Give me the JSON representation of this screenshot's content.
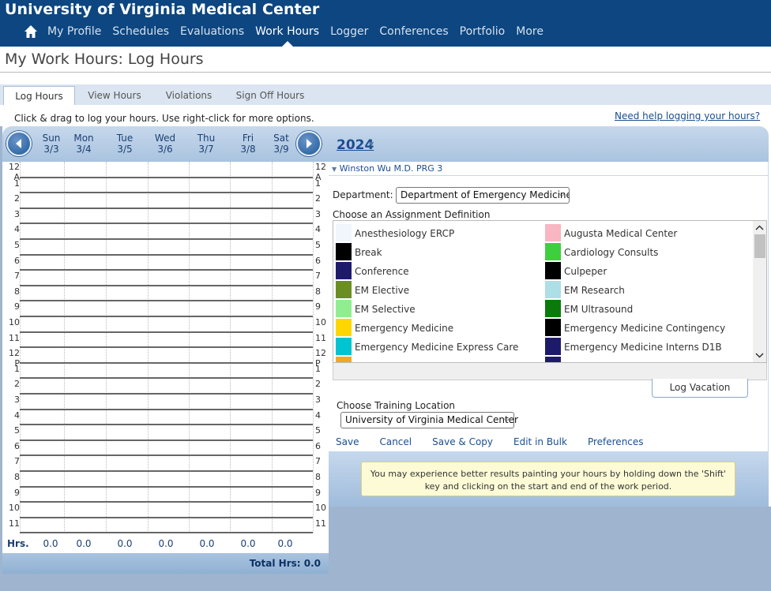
{
  "app": {
    "title": "University of Virginia Medical Center"
  },
  "nav": {
    "items": [
      "My Profile",
      "Schedules",
      "Evaluations",
      "Work Hours",
      "Logger",
      "Conferences",
      "Portfolio",
      "More"
    ],
    "active": "Work Hours"
  },
  "page": {
    "title": "My Work Hours: Log Hours"
  },
  "tabs": [
    "Log Hours",
    "View Hours",
    "Violations",
    "Sign Off Hours"
  ],
  "instruction": "Click & drag to log your hours. Use right-click for more options.",
  "help_link": "Need help logging your hours?",
  "calendar": {
    "year": "2024",
    "days": [
      {
        "name": "Sun",
        "date": "3/3"
      },
      {
        "name": "Mon",
        "date": "3/4"
      },
      {
        "name": "Tue",
        "date": "3/5"
      },
      {
        "name": "Wed",
        "date": "3/6"
      },
      {
        "name": "Thu",
        "date": "3/7"
      },
      {
        "name": "Fri",
        "date": "3/8"
      },
      {
        "name": "Sat",
        "date": "3/9"
      }
    ],
    "hours": [
      "12 A",
      "1",
      "2",
      "3",
      "4",
      "5",
      "6",
      "7",
      "8",
      "9",
      "10",
      "11",
      "12 P",
      "1",
      "2",
      "3",
      "4",
      "5",
      "6",
      "7",
      "8",
      "9",
      "10",
      "11"
    ],
    "hrs_label": "Hrs.",
    "day_totals": [
      "0.0",
      "0.0",
      "0.0",
      "0.0",
      "0.0",
      "0.0",
      "0.0"
    ],
    "total": "Total Hrs: 0.0"
  },
  "resident": "Winston Wu M.D.  PRG 3",
  "department": {
    "label": "Department:",
    "value": "Department of Emergency Medicine"
  },
  "assignment": {
    "label": "Choose an Assignment Definition",
    "items": [
      {
        "name": "Anesthesiology ERCP",
        "color": "#f0f6fc"
      },
      {
        "name": "Augusta Medical Center",
        "color": "#f7b6c2"
      },
      {
        "name": "Break",
        "color": "#000000"
      },
      {
        "name": "Cardiology Consults",
        "color": "#3ecf3e"
      },
      {
        "name": "Conference",
        "color": "#1e1a6b"
      },
      {
        "name": "Culpeper",
        "color": "#000000"
      },
      {
        "name": "EM Elective",
        "color": "#6b8e23"
      },
      {
        "name": "EM Research",
        "color": "#acdfe6"
      },
      {
        "name": "EM Selective",
        "color": "#90ee90"
      },
      {
        "name": "EM Ultrasound",
        "color": "#0a7a0a"
      },
      {
        "name": "Emergency Medicine",
        "color": "#ffd700"
      },
      {
        "name": "Emergency Medicine Contingency",
        "color": "#000000"
      },
      {
        "name": "Emergency Medicine Express Care",
        "color": "#00c4cf"
      },
      {
        "name": "Emergency Medicine Interns D1B",
        "color": "#1e1a6b"
      }
    ]
  },
  "log_vacation": "Log Vacation",
  "training_location": {
    "label": "Choose Training Location",
    "value": "University of Virginia Medical Center"
  },
  "actions": [
    "Save",
    "Cancel",
    "Save & Copy",
    "Edit in Bulk",
    "Preferences"
  ],
  "tip": "You may experience better results painting your hours by holding down the 'Shift' key and clicking on the start and end of the work period."
}
